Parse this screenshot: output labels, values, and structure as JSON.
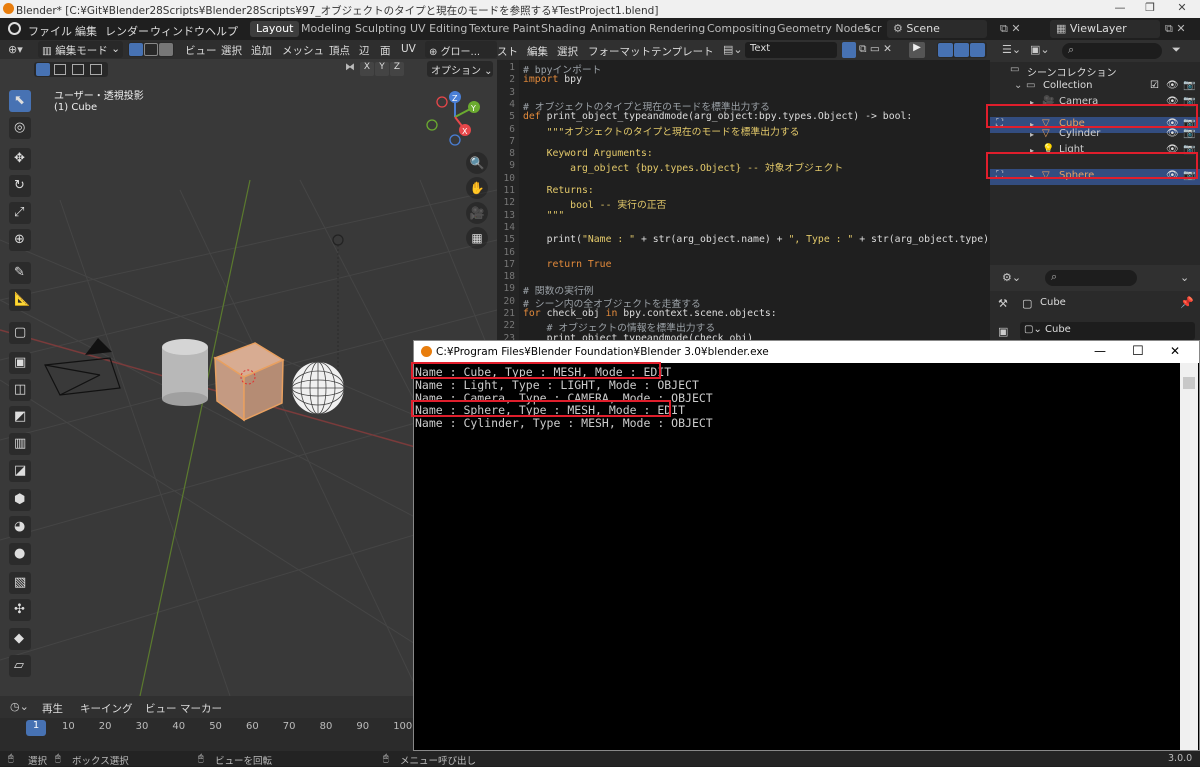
{
  "window": {
    "title": "Blender* [C:¥Git¥Blender28Scripts¥Blender28Scripts¥97_オブジェクトのタイプと現在のモードを参照する¥TestProject1.blend]",
    "controls": [
      "—",
      "❐",
      "✕"
    ]
  },
  "menubar": {
    "items": [
      "ファイル",
      "編集",
      "レンダー",
      "ウィンドウ",
      "ヘルプ"
    ],
    "workspaces": [
      "Layout",
      "Modeling",
      "Sculpting",
      "UV Editing",
      "Texture Paint",
      "Shading",
      "Animation",
      "Rendering",
      "Compositing",
      "Geometry Nodes",
      "Scr"
    ],
    "active_workspace": "Layout",
    "scene": "Scene",
    "view_layer": "ViewLayer"
  },
  "viewport": {
    "mode": "編集モード",
    "menus": [
      "ビュー",
      "選択",
      "追加",
      "メッシュ",
      "頂点",
      "辺",
      "面",
      "UV"
    ],
    "transform": "グロー...",
    "overlay_label": "オプション",
    "axis_buttons": [
      "X",
      "Y",
      "Z"
    ],
    "view_name": "ユーザー・透視投影",
    "object_name": "(1) Cube",
    "gizmo_axes": {
      "z": "Z",
      "y": "Y",
      "x": "X"
    }
  },
  "text_editor": {
    "menus": [
      "スト",
      "編集",
      "選択",
      "フォーマット",
      "テンプレート"
    ],
    "text_name": "Text",
    "lines": [
      {
        "n": "1",
        "html": "<span class='c-com'># bpyインポート</span>"
      },
      {
        "n": "2",
        "html": "<span class='c-kw'>import</span> bpy"
      },
      {
        "n": "3",
        "html": ""
      },
      {
        "n": "4",
        "html": "<span class='c-com'># オブジェクトのタイプと現在のモードを標準出力する</span>"
      },
      {
        "n": "5",
        "html": "<span class='c-kw'>def</span> print_object_typeandmode(arg_object:bpy.types.Object) -> bool:"
      },
      {
        "n": "6",
        "html": "    <span class='c-str'>\"\"\"オブジェクトのタイプと現在のモードを標準出力する</span>"
      },
      {
        "n": "7",
        "html": ""
      },
      {
        "n": "8",
        "html": "<span class='c-str'>    Keyword Arguments:</span>"
      },
      {
        "n": "9",
        "html": "<span class='c-str'>        arg_object {bpy.types.Object} -- 対象オブジェクト</span>"
      },
      {
        "n": "10",
        "html": ""
      },
      {
        "n": "11",
        "html": "<span class='c-str'>    Returns:</span>"
      },
      {
        "n": "12",
        "html": "<span class='c-str'>        bool -- 実行の正否</span>"
      },
      {
        "n": "13",
        "html": "<span class='c-str'>    \"\"\"</span>"
      },
      {
        "n": "14",
        "html": ""
      },
      {
        "n": "15",
        "html": "    print(<span class='c-str'>\"Name : \"</span> + str(arg_object.name) + <span class='c-str'>\", Type : \"</span> + str(arg_object.type) + <span class='c-str'>\", M</span>"
      },
      {
        "n": "16",
        "html": ""
      },
      {
        "n": "17",
        "html": "    <span class='c-kw'>return</span> <span class='c-kw'>True</span>"
      },
      {
        "n": "18",
        "html": ""
      },
      {
        "n": "19",
        "html": "<span class='c-com'># 関数の実行例</span>"
      },
      {
        "n": "20",
        "html": "<span class='c-com'># シーン内の全オブジェクトを走査する</span>"
      },
      {
        "n": "21",
        "html": "<span class='c-kw'>for</span> check_obj <span class='c-kw'>in</span> bpy.context.scene.objects:"
      },
      {
        "n": "22",
        "html": "    <span class='c-com'># オブジェクトの情報を標準出力する</span>"
      },
      {
        "n": "23",
        "html": "    print_object_typeandmode(check_obj)"
      }
    ]
  },
  "outliner": {
    "root": "シーンコレクション",
    "collection": "Collection",
    "items": [
      {
        "name": "Camera",
        "color": "#cfcfcf"
      },
      {
        "name": "Cube",
        "color": "#e8a060"
      },
      {
        "name": "Cylinder",
        "color": "#cfcfcf"
      },
      {
        "name": "Light",
        "color": "#cfcfcf"
      },
      {
        "name": "Sphere",
        "color": "#e8a060"
      }
    ]
  },
  "properties": {
    "object": "Cube",
    "data": "Cube"
  },
  "console": {
    "title": "C:¥Program Files¥Blender Foundation¥Blender 3.0¥blender.exe",
    "lines": [
      "Name : Cube, Type : MESH, Mode : EDIT",
      "Name : Light, Type : LIGHT, Mode : OBJECT",
      "Name : Camera, Type : CAMERA, Mode : OBJECT",
      "Name : Sphere, Type : MESH, Mode : EDIT",
      "Name : Cylinder, Type : MESH, Mode : OBJECT"
    ],
    "controls": [
      "—",
      "☐",
      "✕"
    ]
  },
  "timeline": {
    "menus": [
      "再生",
      "キーイング",
      "ビュー",
      "マーカー"
    ],
    "current_frame": "1",
    "ticks": [
      "10",
      "20",
      "30",
      "40",
      "50",
      "60",
      "70",
      "80",
      "90",
      "100"
    ]
  },
  "statusbar": {
    "select": "選択",
    "box_select": "ボックス選択",
    "rotate": "ビューを回転",
    "menu": "メニュー呼び出し",
    "version": "3.0.0"
  },
  "colors": {
    "accent": "#4772b3",
    "highlight_red": "#e01e2c",
    "selected_object": "#e8a060"
  }
}
